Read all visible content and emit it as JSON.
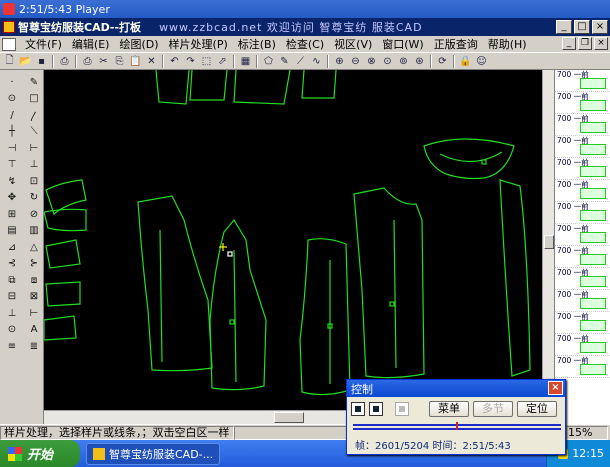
{
  "player": {
    "title": "2:51/5:43 Player"
  },
  "app": {
    "title": "智尊宝纺服装CAD--打板",
    "marquee": "www.zzbcad.net 欢迎访问 智尊宝纺 服装CAD"
  },
  "menu": [
    "文件(F)",
    "编辑(E)",
    "绘图(D)",
    "样片处理(P)",
    "标注(B)",
    "检查(C)",
    "视区(V)",
    "窗口(W)",
    "正版查询",
    "帮助(H)"
  ],
  "toolbar_icons": [
    "new-icon",
    "open-icon",
    "save-icon",
    "print-preview-icon",
    "print-icon",
    "cut-icon",
    "copy-icon",
    "paste-icon",
    "delete-icon",
    "undo-icon",
    "redo-icon",
    "select-icon",
    "pointer-icon",
    "measure-icon",
    "draw-icon",
    "zoom-in-icon",
    "zoom-out-icon",
    "zoom-window-icon",
    "zoom-all-icon",
    "pan-icon",
    "refresh-icon",
    "lock-icon",
    "person-icon"
  ],
  "left_tools": [
    "·",
    "✎",
    "⊙",
    "□",
    "/",
    "〳",
    "┼",
    "⟍",
    "⊣",
    "⊢",
    "⊤",
    "⊥",
    "↯",
    "⊡",
    "✥",
    "↻",
    "⊞",
    "⊘",
    "▤",
    "▥",
    "⊿",
    "△",
    "⊰",
    "⊱",
    "⧉",
    "⧈",
    "⊟",
    "⊠",
    "⊥",
    "⊢",
    "⊙",
    "A",
    "≡",
    "≣"
  ],
  "pieces": [
    {
      "label": "700 一前"
    },
    {
      "label": "700 一前"
    },
    {
      "label": "700 一前"
    },
    {
      "label": "700 一前"
    },
    {
      "label": "700 一前"
    },
    {
      "label": "700 一前"
    },
    {
      "label": "700 一前"
    },
    {
      "label": "700 一前"
    },
    {
      "label": "700 一前"
    },
    {
      "label": "700 一前"
    },
    {
      "label": "700 一前"
    },
    {
      "label": "700 一前"
    },
    {
      "label": "700 一前"
    },
    {
      "label": "700 一前"
    }
  ],
  "status": {
    "hint": "样片处理，选择样片或线条，；双击空白区一样",
    "right": "15%"
  },
  "taskbar": {
    "start": "开始",
    "task": "智尊宝纺服装CAD-...",
    "time": "12:15"
  },
  "control": {
    "title": "控制",
    "menu_btn": "菜单",
    "multi_btn": "多节",
    "locate_btn": "定位",
    "frame_label": "帧：",
    "frame": "2601/5204",
    "time_label": "时间：",
    "time": "2:51/5:43",
    "progress": 0.5
  },
  "colors": {
    "canvas_bg": "#000000",
    "pattern_line": "#22dd22",
    "cursor": "#ffee00"
  }
}
